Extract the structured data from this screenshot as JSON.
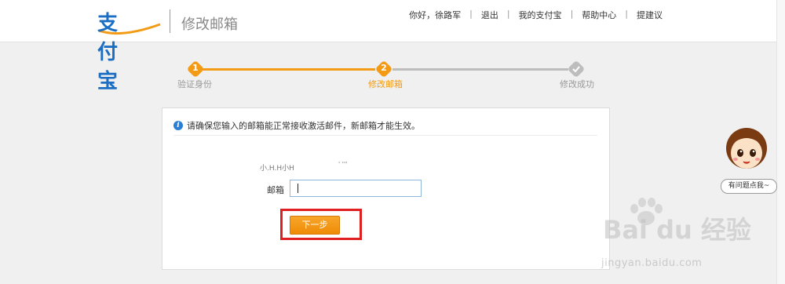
{
  "header": {
    "logo_text": "支付宝",
    "page_title": "修改邮箱",
    "nav": [
      {
        "label": "你好，徐路军"
      },
      {
        "label": "退出"
      },
      {
        "label": "我的支付宝"
      },
      {
        "label": "帮助中心"
      },
      {
        "label": "提建议"
      }
    ]
  },
  "steps": [
    {
      "number": "1",
      "label": "验证身份",
      "state": "done"
    },
    {
      "number": "2",
      "label": "修改邮箱",
      "state": "active"
    },
    {
      "number": "",
      "label": "修改成功",
      "state": "pending"
    }
  ],
  "colors": {
    "accent": "#f39b14",
    "inactive": "#bdbdbd",
    "highlight": "#e02020",
    "info": "#2a7fd4"
  },
  "card": {
    "notice": "请确保您输入的邮箱能正常接收激活邮件，新邮箱才能生效。",
    "ghost_label": "小.H.H小H",
    "ghost_value": "  '  '''",
    "email_label": "邮箱",
    "email_value": "",
    "next_button": "下一步"
  },
  "helper": {
    "label": "有问题点我~"
  },
  "watermark": {
    "brand": "Bai du 经验",
    "url": "jingyan.baidu.com"
  }
}
